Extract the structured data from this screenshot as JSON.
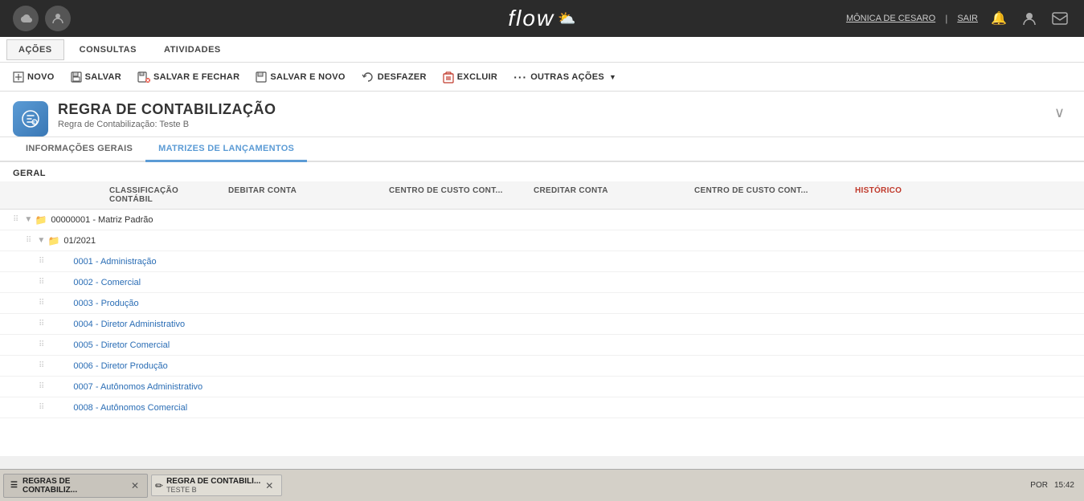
{
  "topbar": {
    "logo": "flow",
    "user": "MÔNICA DE CESARO",
    "logout": "SAIR",
    "separator": "|"
  },
  "navbar": {
    "items": [
      {
        "id": "acoes",
        "label": "AÇÕES",
        "active": true
      },
      {
        "id": "consultas",
        "label": "CONSULTAS",
        "active": false
      },
      {
        "id": "atividades",
        "label": "ATIVIDADES",
        "active": false
      }
    ]
  },
  "toolbar": {
    "buttons": [
      {
        "id": "novo",
        "label": "NOVO",
        "icon": "☐"
      },
      {
        "id": "salvar",
        "label": "SALVAR",
        "icon": "💾"
      },
      {
        "id": "salvar-fechar",
        "label": "SALVAR E FECHAR",
        "icon": "💾"
      },
      {
        "id": "salvar-novo",
        "label": "SALVAR E NOVO",
        "icon": "💾"
      },
      {
        "id": "desfazer",
        "label": "DESFAZER",
        "icon": "↺"
      },
      {
        "id": "excluir",
        "label": "EXCLUIR",
        "icon": "🗑"
      },
      {
        "id": "outras-acoes",
        "label": "OUTRAS AÇÕES",
        "icon": "···"
      }
    ]
  },
  "page": {
    "title": "REGRA DE CONTABILIZAÇÃO",
    "subtitle": "Regra de Contabilização: Teste B"
  },
  "tabs": [
    {
      "id": "info-gerais",
      "label": "INFORMAÇÕES GERAIS",
      "active": false
    },
    {
      "id": "matrizes",
      "label": "MATRIZES DE LANÇAMENTOS",
      "active": true
    }
  ],
  "section": {
    "label": "GERAL"
  },
  "table": {
    "columns": [
      {
        "id": "classificacao",
        "label": "CLASSIFICAÇÃO CONTÁBIL",
        "red": false
      },
      {
        "id": "debitar",
        "label": "DEBITAR CONTA",
        "red": false
      },
      {
        "id": "centro-debitar",
        "label": "CENTRO DE CUSTO CONT...",
        "red": false
      },
      {
        "id": "creditar",
        "label": "CREDITAR CONTA",
        "red": false
      },
      {
        "id": "centro-creditar",
        "label": "CENTRO DE CUSTO CONT...",
        "red": false
      },
      {
        "id": "historico",
        "label": "HISTÓRICO",
        "red": true
      }
    ]
  },
  "tree": {
    "rows": [
      {
        "id": "matriz-padrao",
        "level": 0,
        "type": "folder-parent",
        "text": "00000001 - Matriz Padrão",
        "link": false
      },
      {
        "id": "periodo",
        "level": 1,
        "type": "folder",
        "text": "01/2021",
        "link": false
      },
      {
        "id": "row-0001",
        "level": 2,
        "type": "item",
        "text": "0001 - Administração",
        "link": true
      },
      {
        "id": "row-0002",
        "level": 2,
        "type": "item",
        "text": "0002 - Comercial",
        "link": true
      },
      {
        "id": "row-0003",
        "level": 2,
        "type": "item",
        "text": "0003 - Produção",
        "link": true
      },
      {
        "id": "row-0004",
        "level": 2,
        "type": "item",
        "text": "0004 - Diretor Administrativo",
        "link": true
      },
      {
        "id": "row-0005",
        "level": 2,
        "type": "item",
        "text": "0005 - Diretor Comercial",
        "link": true
      },
      {
        "id": "row-0006",
        "level": 2,
        "type": "item",
        "text": "0006 - Diretor Produção",
        "link": true
      },
      {
        "id": "row-0007",
        "level": 2,
        "type": "item",
        "text": "0007 - Autônomos Administrativo",
        "link": true
      },
      {
        "id": "row-0008",
        "level": 2,
        "type": "item",
        "text": "0008 - Autônomos Comercial",
        "link": true
      }
    ]
  },
  "taskbar": {
    "items": [
      {
        "id": "regras",
        "label": "REGRAS DE CONTABILIZ...",
        "icon": "☰",
        "closable": true
      }
    ],
    "active_item": {
      "title": "REGRA DE CONTABILI...",
      "subtitle": "TESTE B",
      "icon": "✏"
    },
    "right": {
      "label": "POR",
      "time": "15:42"
    }
  }
}
